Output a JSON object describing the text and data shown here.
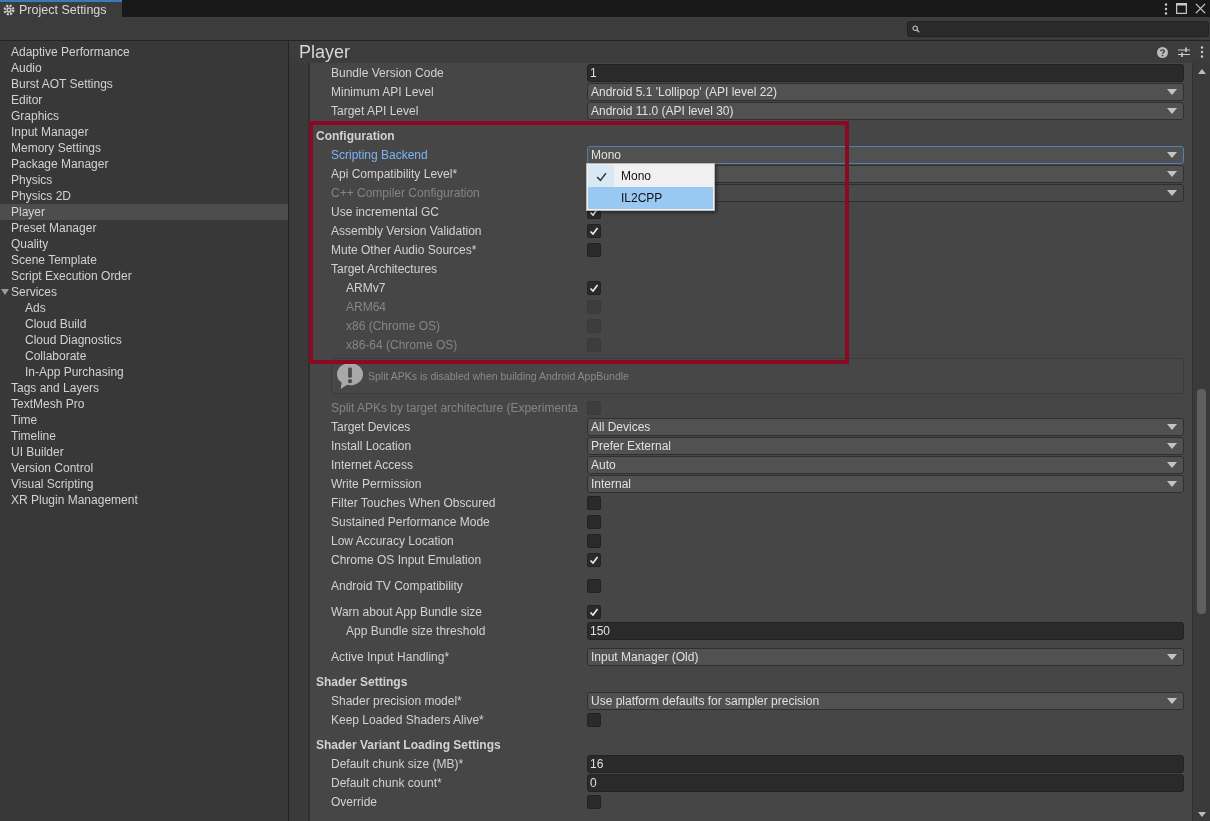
{
  "window": {
    "title": "Project Settings"
  },
  "sidebar": {
    "items": [
      {
        "label": "Adaptive Performance",
        "selected": false
      },
      {
        "label": "Audio",
        "selected": false
      },
      {
        "label": "Burst AOT Settings",
        "selected": false
      },
      {
        "label": "Editor",
        "selected": false
      },
      {
        "label": "Graphics",
        "selected": false
      },
      {
        "label": "Input Manager",
        "selected": false
      },
      {
        "label": "Memory Settings",
        "selected": false
      },
      {
        "label": "Package Manager",
        "selected": false
      },
      {
        "label": "Physics",
        "selected": false
      },
      {
        "label": "Physics 2D",
        "selected": false
      },
      {
        "label": "Player",
        "selected": true
      },
      {
        "label": "Preset Manager",
        "selected": false
      },
      {
        "label": "Quality",
        "selected": false
      },
      {
        "label": "Scene Template",
        "selected": false
      },
      {
        "label": "Script Execution Order",
        "selected": false
      },
      {
        "label": "Services",
        "selected": false,
        "expanded": true,
        "children": [
          {
            "label": "Ads",
            "selected": false
          },
          {
            "label": "Cloud Build",
            "selected": false
          },
          {
            "label": "Cloud Diagnostics",
            "selected": false
          },
          {
            "label": "Collaborate",
            "selected": false
          },
          {
            "label": "In-App Purchasing",
            "selected": false
          }
        ]
      },
      {
        "label": "Tags and Layers",
        "selected": false
      },
      {
        "label": "TextMesh Pro",
        "selected": false
      },
      {
        "label": "Time",
        "selected": false
      },
      {
        "label": "Timeline",
        "selected": false
      },
      {
        "label": "UI Builder",
        "selected": false
      },
      {
        "label": "Version Control",
        "selected": false
      },
      {
        "label": "Visual Scripting",
        "selected": false
      },
      {
        "label": "XR Plugin Management",
        "selected": false
      }
    ]
  },
  "panel": {
    "title": "Player"
  },
  "rows": [
    {
      "kind": "text",
      "label": "Bundle Version Code",
      "value": "1",
      "disabled": false
    },
    {
      "kind": "dropdown",
      "label": "Minimum API Level",
      "value": "Android 5.1 'Lollipop' (API level 22)",
      "disabled": false
    },
    {
      "kind": "dropdown",
      "label": "Target API Level",
      "value": "Android 11.0 (API level 30)",
      "disabled": false
    },
    {
      "kind": "header",
      "label": "Configuration"
    },
    {
      "kind": "dropdown",
      "label": "Scripting Backend",
      "value": "Mono",
      "disabled": false,
      "focused": true
    },
    {
      "kind": "dropdown",
      "label": "Api Compatibility Level*",
      "disabled": false
    },
    {
      "kind": "dropdown",
      "label": "C++ Compiler Configuration",
      "disabled": true
    },
    {
      "kind": "checkbox",
      "label": "Use incremental GC",
      "checked": true,
      "disabled": false
    },
    {
      "kind": "checkbox",
      "label": "Assembly Version Validation",
      "checked": true,
      "disabled": false
    },
    {
      "kind": "checkbox",
      "label": "Mute Other Audio Sources*",
      "checked": false,
      "disabled": false
    },
    {
      "kind": "label",
      "label": "Target Architectures",
      "children": [
        {
          "kind": "checkbox",
          "label": "ARMv7",
          "checked": true,
          "disabled": false
        },
        {
          "kind": "checkbox",
          "label": "ARM64",
          "checked": false,
          "disabled": true
        },
        {
          "kind": "checkbox",
          "label": "x86 (Chrome OS)",
          "checked": false,
          "disabled": true
        },
        {
          "kind": "checkbox",
          "label": "x86-64 (Chrome OS)",
          "checked": false,
          "disabled": true
        }
      ]
    },
    {
      "kind": "note",
      "label": "Split APKs is disabled when building Android AppBundle"
    },
    {
      "kind": "checkbox",
      "label": "Split APKs by target architecture (Experimenta",
      "checked": false,
      "disabled": true
    },
    {
      "kind": "dropdown",
      "label": "Target Devices",
      "value": "All Devices",
      "disabled": false
    },
    {
      "kind": "dropdown",
      "label": "Install Location",
      "value": "Prefer External",
      "disabled": false
    },
    {
      "kind": "dropdown",
      "label": "Internet Access",
      "value": "Auto",
      "disabled": false
    },
    {
      "kind": "dropdown",
      "label": "Write Permission",
      "value": "Internal",
      "disabled": false
    },
    {
      "kind": "checkbox",
      "label": "Filter Touches When Obscured",
      "checked": false,
      "disabled": false
    },
    {
      "kind": "checkbox",
      "label": "Sustained Performance Mode",
      "checked": false,
      "disabled": false
    },
    {
      "kind": "checkbox",
      "label": "Low Accuracy Location",
      "checked": false,
      "disabled": false
    },
    {
      "kind": "checkbox",
      "label": "Chrome OS Input Emulation",
      "checked": true,
      "disabled": false
    },
    {
      "kind": "checkbox",
      "label": "Android TV Compatibility",
      "checked": false,
      "disabled": false,
      "spaced": true
    },
    {
      "kind": "checkbox",
      "label": "Warn about App Bundle size",
      "checked": true,
      "disabled": false,
      "spaced": true,
      "children": [
        {
          "kind": "text",
          "label": "App Bundle size threshold",
          "value": "150",
          "disabled": false
        }
      ]
    },
    {
      "kind": "dropdown",
      "label": "Active Input Handling*",
      "value": "Input Manager (Old)",
      "disabled": false,
      "spaced": true
    },
    {
      "kind": "header",
      "label": "Shader Settings"
    },
    {
      "kind": "dropdown",
      "label": "Shader precision model*",
      "value": "Use platform defaults for sampler precision",
      "disabled": false
    },
    {
      "kind": "checkbox",
      "label": "Keep Loaded Shaders Alive*",
      "checked": false,
      "disabled": false
    },
    {
      "kind": "header",
      "label": "Shader Variant Loading Settings"
    },
    {
      "kind": "text",
      "label": "Default chunk size (MB)*",
      "value": "16",
      "disabled": false
    },
    {
      "kind": "text",
      "label": "Default chunk count*",
      "value": "0",
      "disabled": false
    },
    {
      "kind": "checkbox",
      "label": "Override",
      "checked": false,
      "disabled": false
    }
  ],
  "popup": {
    "items": [
      {
        "label": "Mono",
        "selected": true,
        "hovered": false
      },
      {
        "label": "IL2CPP",
        "selected": false,
        "hovered": true
      }
    ]
  }
}
